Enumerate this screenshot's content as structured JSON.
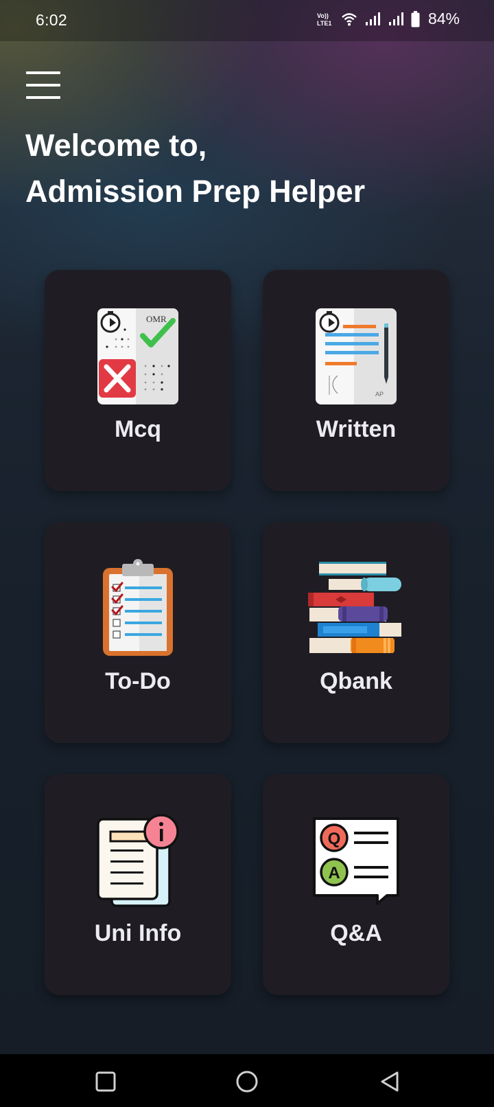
{
  "status_bar": {
    "time": "6:02",
    "network_label": "Vo)) LTE1",
    "battery": "84%"
  },
  "header": {
    "welcome_line1": "Welcome to,",
    "welcome_line2": "Admission Prep Helper"
  },
  "cards": [
    {
      "label": "Mcq",
      "icon": "mcq-omr-sheet-icon"
    },
    {
      "label": "Written",
      "icon": "written-exam-sheet-icon"
    },
    {
      "label": "To-Do",
      "icon": "clipboard-checklist-icon"
    },
    {
      "label": "Qbank",
      "icon": "book-stack-icon"
    },
    {
      "label": "Uni Info",
      "icon": "info-document-icon"
    },
    {
      "label": "Q&A",
      "icon": "qa-chat-icon"
    }
  ],
  "mcq_icon_text": "OMR",
  "navigation": [
    "recents-icon",
    "home-icon",
    "back-icon"
  ],
  "colors": {
    "card_bg": "#1f1d23",
    "label": "#ececf0",
    "check_green": "#3fbf4b",
    "cross_red": "#e23a44"
  }
}
